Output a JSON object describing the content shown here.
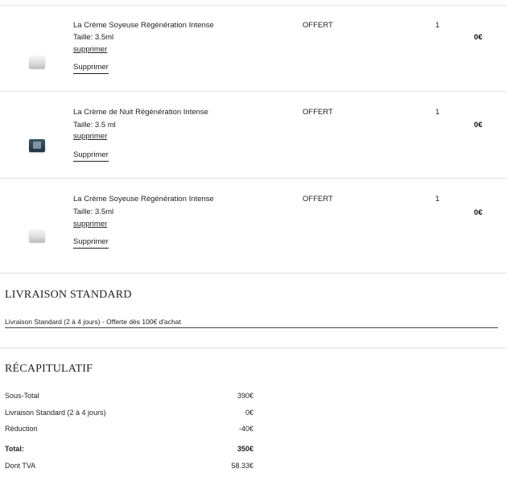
{
  "items": [
    {
      "name": "La Crème Soyeuse Régénération Intense",
      "size": "Taille: 3.5ml",
      "remove_link": "supprimer",
      "remove_button": "Supprimer",
      "offer": "OFFERT",
      "qty": "1",
      "price": "0€",
      "thumb": "white-cream-jar"
    },
    {
      "name": "La Crème de Nuit Régénération Intense",
      "size": "Taille: 3.5 ml",
      "remove_link": "supprimer",
      "remove_button": "Supprimer",
      "offer": "OFFERT",
      "qty": "1",
      "price": "0€",
      "thumb": "dark-cream-jar"
    },
    {
      "name": "La Crème Soyeuse Régénération Intense",
      "size": "Taille: 3.5ml",
      "remove_link": "supprimer",
      "remove_button": "Supprimer",
      "offer": "OFFERT",
      "qty": "1",
      "price": "0€",
      "thumb": "white-cream-jar"
    }
  ],
  "shipping": {
    "title": "LIVRAISON STANDARD",
    "option": "Livraison Standard (2 à 4 jours) - Offerte dès 100€ d'achat"
  },
  "summary": {
    "title": "RÉCAPITULATIF",
    "rows": [
      {
        "label": "Sous-Total",
        "value": "390€"
      },
      {
        "label": "Livraison Standard (2 à 4 jours)",
        "value": "0€"
      },
      {
        "label": "Réduction",
        "value": "-40€"
      },
      {
        "label": "Total:",
        "value": "350€"
      },
      {
        "label": "Dont TVA",
        "value": "58.33€"
      }
    ]
  }
}
